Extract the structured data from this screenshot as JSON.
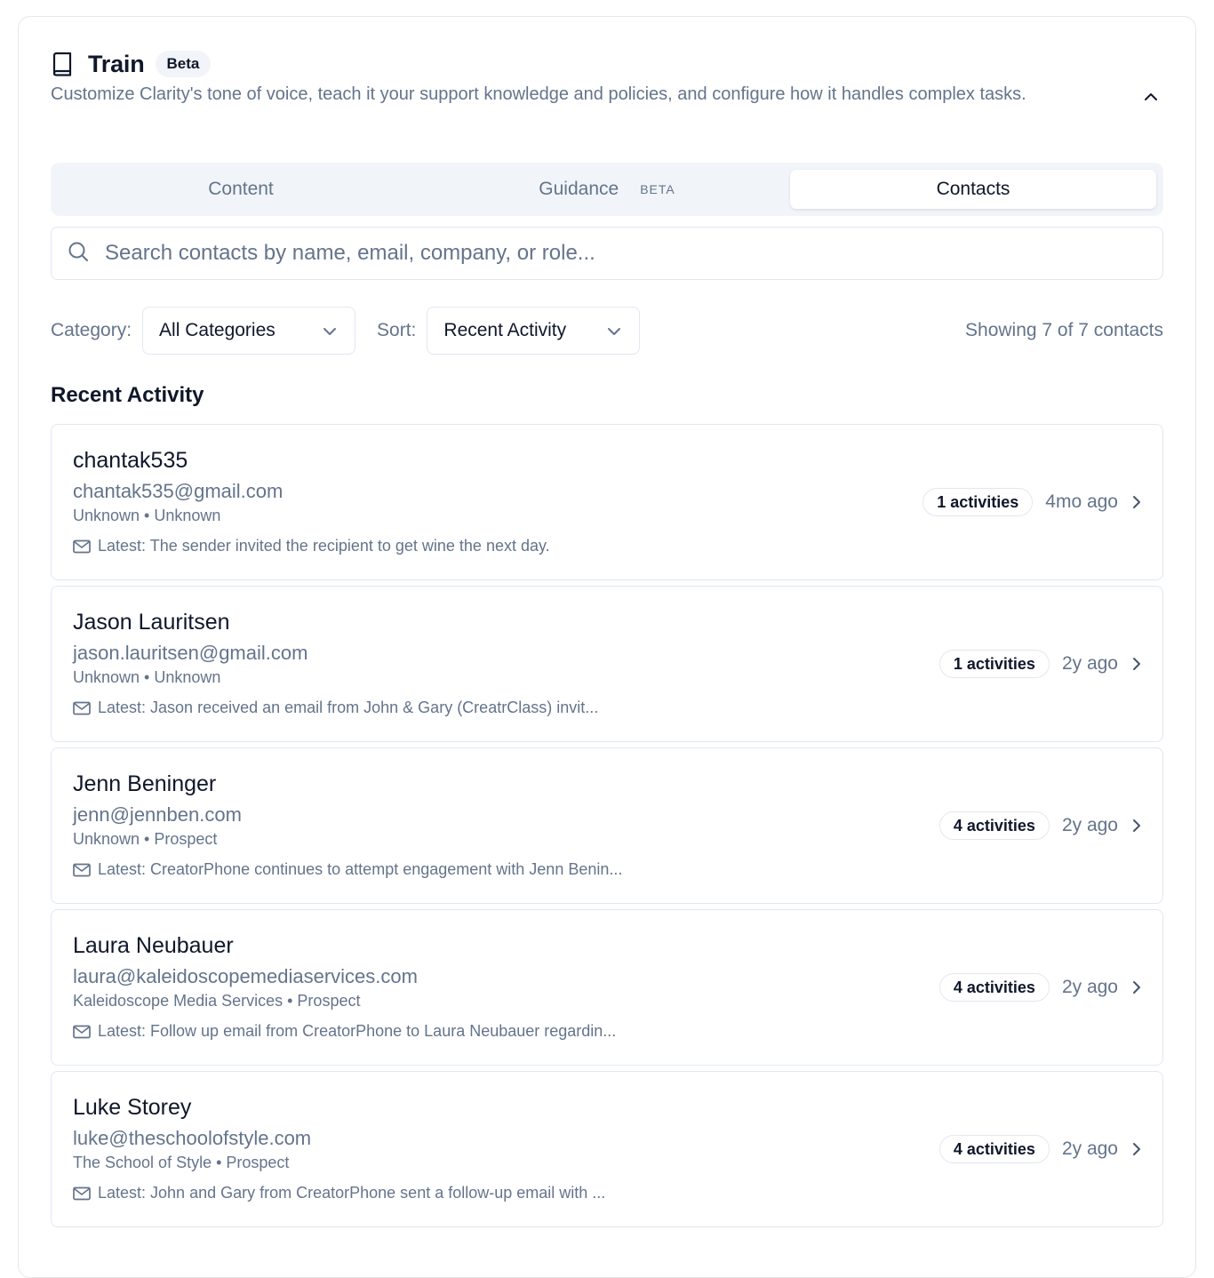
{
  "header": {
    "title": "Train",
    "badge": "Beta",
    "description": "Customize Clarity's tone of voice, teach it your support knowledge and policies, and configure how it handles complex tasks.",
    "icon": "book-icon",
    "collapse_icon": "chevron-up-icon"
  },
  "tabs": [
    {
      "label": "Content",
      "active": false
    },
    {
      "label": "Guidance",
      "badge": "BETA",
      "active": false
    },
    {
      "label": "Contacts",
      "active": true
    }
  ],
  "search": {
    "placeholder": "Search contacts by name, email, company, or role...",
    "value": "",
    "icon": "search-icon"
  },
  "filters": {
    "category_label": "Category:",
    "category_value": "All Categories",
    "sort_label": "Sort:",
    "sort_value": "Recent Activity",
    "showing": "Showing 7 of 7 contacts"
  },
  "section_title": "Recent Activity",
  "contacts": [
    {
      "name": "chantak535",
      "email": "chantak535@gmail.com",
      "meta": "Unknown • Unknown",
      "latest": "Latest: The sender invited the recipient to get wine the next day.",
      "activities": "1 activities",
      "time": "4mo ago"
    },
    {
      "name": "Jason Lauritsen",
      "email": "jason.lauritsen@gmail.com",
      "meta": "Unknown • Unknown",
      "latest": "Latest: Jason received an email from John & Gary (CreatrClass) invit...",
      "activities": "1 activities",
      "time": "2y ago"
    },
    {
      "name": "Jenn Beninger",
      "email": "jenn@jennben.com",
      "meta": "Unknown • Prospect",
      "latest": "Latest: CreatorPhone continues to attempt engagement with Jenn Benin...",
      "activities": "4 activities",
      "time": "2y ago"
    },
    {
      "name": "Laura Neubauer",
      "email": "laura@kaleidoscopemediaservices.com",
      "meta": "Kaleidoscope Media Services • Prospect",
      "latest": "Latest: Follow up email from CreatorPhone to Laura Neubauer regardin...",
      "activities": "4 activities",
      "time": "2y ago"
    },
    {
      "name": "Luke Storey",
      "email": "luke@theschoolofstyle.com",
      "meta": "The School of Style • Prospect",
      "latest": "Latest: John and Gary from CreatorPhone sent a follow-up email with ...",
      "activities": "4 activities",
      "time": "2y ago"
    }
  ]
}
